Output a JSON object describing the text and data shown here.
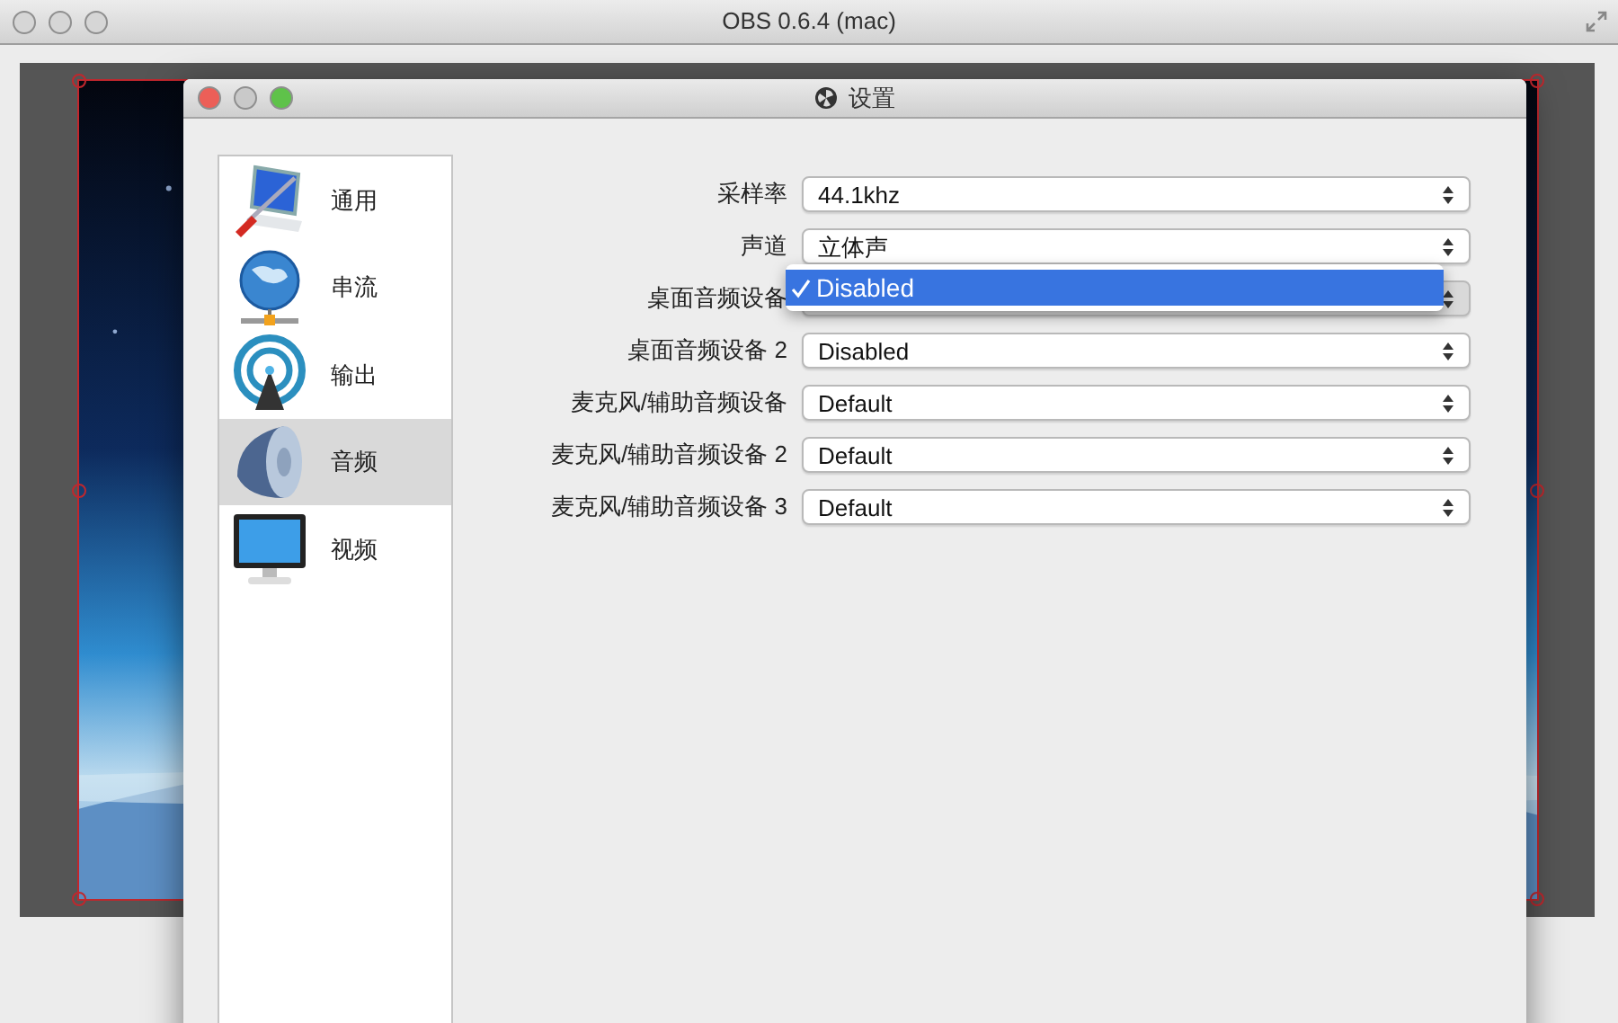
{
  "main_window": {
    "title": "OBS 0.6.4 (mac)"
  },
  "dialog": {
    "title": "设置",
    "sidebar": {
      "items": [
        {
          "label": "通用",
          "kind": "tools",
          "selected": false
        },
        {
          "label": "串流",
          "kind": "globe",
          "selected": false
        },
        {
          "label": "输出",
          "kind": "antenna",
          "selected": false
        },
        {
          "label": "音频",
          "kind": "speaker",
          "selected": true
        },
        {
          "label": "视频",
          "kind": "monitor",
          "selected": false
        }
      ]
    },
    "fields": [
      {
        "label": "采样率",
        "value": "44.1khz",
        "open": false
      },
      {
        "label": "声道",
        "value": "立体声",
        "open": false
      },
      {
        "label": "桌面音频设备",
        "open": true,
        "options": [
          {
            "label": "Disabled",
            "selected": true
          }
        ]
      },
      {
        "label": "桌面音频设备 2",
        "value": "Disabled",
        "open": false
      },
      {
        "label": "麦克风/辅助音频设备",
        "value": "Default",
        "open": false
      },
      {
        "label": "麦克风/辅助音频设备 2",
        "value": "Default",
        "open": false
      },
      {
        "label": "麦克风/辅助音频设备 3",
        "value": "Default",
        "open": false
      }
    ]
  }
}
